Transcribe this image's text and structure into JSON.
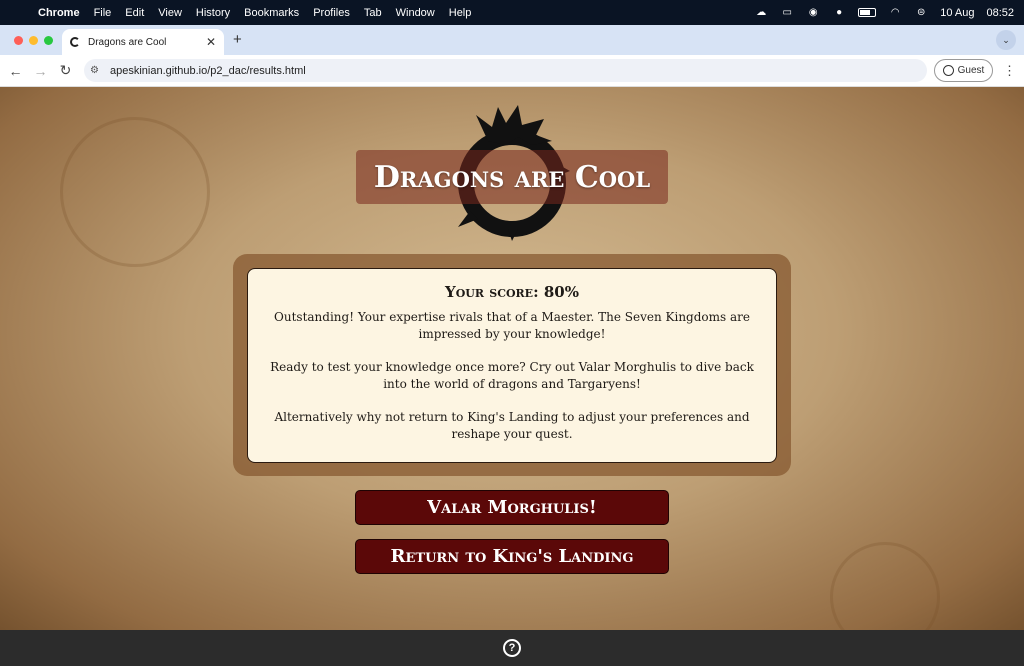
{
  "menubar": {
    "app": "Chrome",
    "items": [
      "File",
      "Edit",
      "View",
      "History",
      "Bookmarks",
      "Profiles",
      "Tab",
      "Window",
      "Help"
    ],
    "date": "10 Aug",
    "time": "08:52"
  },
  "browser": {
    "tab_title": "Dragons are Cool",
    "url": "apeskinian.github.io/p2_dac/results.html",
    "profile": "Guest"
  },
  "page": {
    "title": "Dragons are Cool",
    "score": "Your score: 80%",
    "paragraphs": [
      "Outstanding! Your expertise rivals that of a Maester. The Seven Kingdoms are impressed by your knowledge!",
      "Ready to test your knowledge once more? Cry out Valar Morghulis to dive back into the world of dragons and Targaryens!",
      "Alternatively why not return to King's Landing to adjust your preferences and reshape your quest."
    ],
    "buttons": {
      "restart": "Valar Morghulis!",
      "home": "Return to King's Landing"
    }
  },
  "footer": {
    "help_icon": "?"
  },
  "colors": {
    "button_bg": "#5b0808",
    "card_bg": "#fdf5e2",
    "footer_bg": "#2c2c2c"
  }
}
